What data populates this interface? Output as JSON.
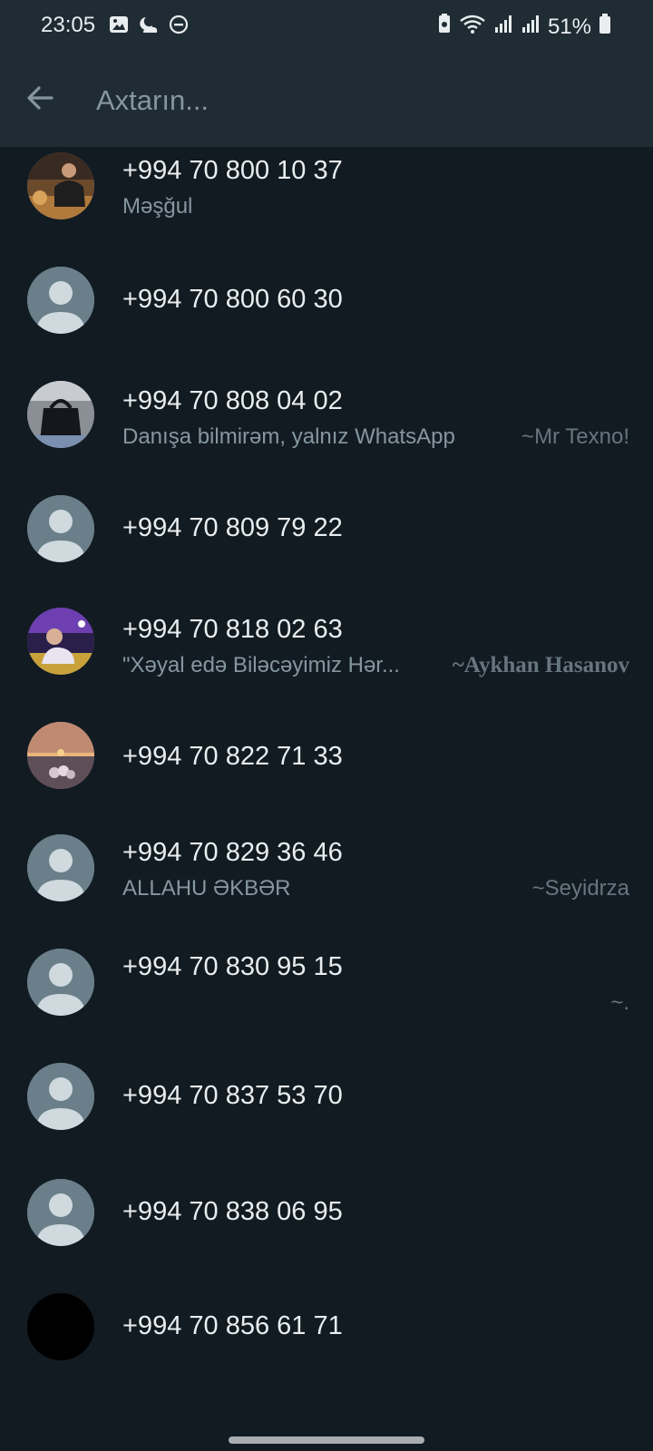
{
  "status_bar": {
    "time": "23:05",
    "battery": "51%",
    "left_icons": [
      "image-icon",
      "weather-icon",
      "dnd-icon"
    ],
    "right_icons": [
      "battery-saver-icon",
      "wifi-icon",
      "signal-icon",
      "signal-icon",
      "battery-icon"
    ]
  },
  "search": {
    "placeholder": "Axtarın...",
    "value": ""
  },
  "contacts": [
    {
      "phone": "+994 70 800 10 37",
      "status": "Məşğul",
      "alias": "",
      "avatar": "photo-man-at-table"
    },
    {
      "phone": "+994 70 800 60 30",
      "status": "",
      "alias": "",
      "avatar": "default"
    },
    {
      "phone": "+994 70 808 04 02",
      "status": "Danışa bilmirəm, yalnız WhatsApp",
      "alias": "~Mr Texno!",
      "avatar": "photo-black-bag"
    },
    {
      "phone": "+994 70 809 79 22",
      "status": "",
      "alias": "",
      "avatar": "default"
    },
    {
      "phone": "+994 70 818 02 63",
      "status": "\"Xəyal edə Biləcəyimiz Hər...",
      "alias": "~Aykhan Hasanov",
      "avatar": "photo-man-purple-light"
    },
    {
      "phone": "+994 70 822 71 33",
      "status": "",
      "alias": "",
      "avatar": "photo-sunset-flowers"
    },
    {
      "phone": "+994 70 829 36 46",
      "status": "ALLAHU ƏKBƏR",
      "alias": "~Seyidrza",
      "avatar": "default"
    },
    {
      "phone": "+994 70 830 95 15",
      "status": "",
      "alias": "~.",
      "avatar": "default"
    },
    {
      "phone": "+994 70 837 53 70",
      "status": "",
      "alias": "",
      "avatar": "default"
    },
    {
      "phone": "+994 70 838 06 95",
      "status": "",
      "alias": "",
      "avatar": "default"
    },
    {
      "phone": "+994 70 856 61 71",
      "status": "",
      "alias": "",
      "avatar": "black"
    }
  ],
  "colors": {
    "background": "#121b22",
    "header": "#1f2c34",
    "primary_text": "#e9edef",
    "secondary_text": "#8696a0",
    "default_avatar": "#6a7f8a"
  }
}
